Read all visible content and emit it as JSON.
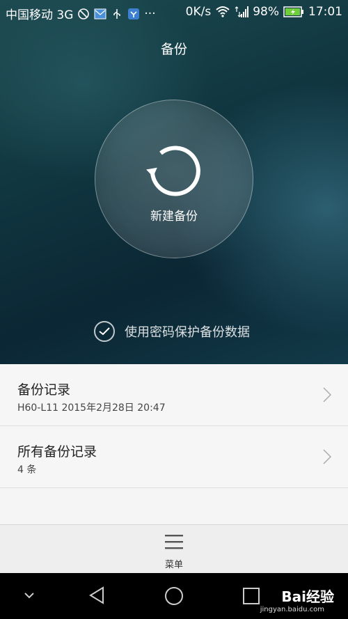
{
  "status_bar": {
    "carrier": "中国移动 3G",
    "dots": "···",
    "speed": "0K/s",
    "battery": "98%",
    "time": "17:01"
  },
  "header": {
    "title": "备份"
  },
  "backup_button": {
    "label": "新建备份"
  },
  "password_option": {
    "label": "使用密码保护备份数据",
    "checked": true
  },
  "list": {
    "items": [
      {
        "title": "备份记录",
        "subtitle": "H60-L11  2015年2月28日 20:47"
      },
      {
        "title": "所有备份记录",
        "subtitle": "4 条"
      }
    ]
  },
  "bottom_menu": {
    "label": "菜单"
  },
  "watermark": {
    "text": "Bai经验",
    "sub": "jingyan.baidu.com"
  },
  "colors": {
    "hero_dark": "#0b2634",
    "battery_green": "#6fcf3a"
  }
}
